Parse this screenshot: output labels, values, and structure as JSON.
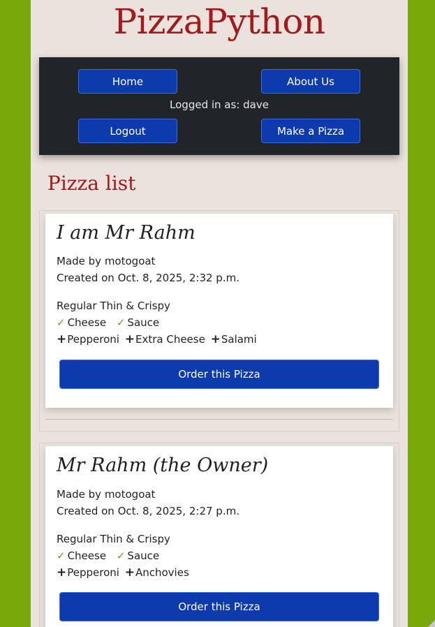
{
  "site": {
    "title": "PizzaPython"
  },
  "nav": {
    "home_label": "Home",
    "about_label": "About Us",
    "logged_in_text": "Logged in as: dave",
    "logout_label": "Logout",
    "make_pizza_label": "Make a Pizza"
  },
  "section": {
    "title": "Pizza list"
  },
  "pizzas": [
    {
      "name": "I am Mr Rahm",
      "made_by": "Made by motogoat",
      "created": "Created on Oct. 8, 2025, 2:32 p.m.",
      "base": "Regular Thin & Crispy",
      "ingredients": [
        "Cheese",
        "Sauce"
      ],
      "toppings": [
        "Pepperoni",
        "Extra Cheese",
        "Salami"
      ],
      "order_label": "Order this Pizza"
    },
    {
      "name": "Mr Rahm (the Owner)",
      "made_by": "Made by motogoat",
      "created": "Created on Oct. 8, 2025, 2:27 p.m.",
      "base": "Regular Thin & Crispy",
      "ingredients": [
        "Cheese",
        "Sauce"
      ],
      "toppings": [
        "Pepperoni",
        "Anchovies"
      ],
      "order_label": "Order this Pizza"
    }
  ],
  "icons": {
    "check": "checkmark-icon",
    "plus": "plus-icon"
  },
  "colors": {
    "background": "#79a80a",
    "page": "#ebe2dd",
    "title": "#a41a1a",
    "navbar": "#212428",
    "button": "#0d3aac"
  }
}
